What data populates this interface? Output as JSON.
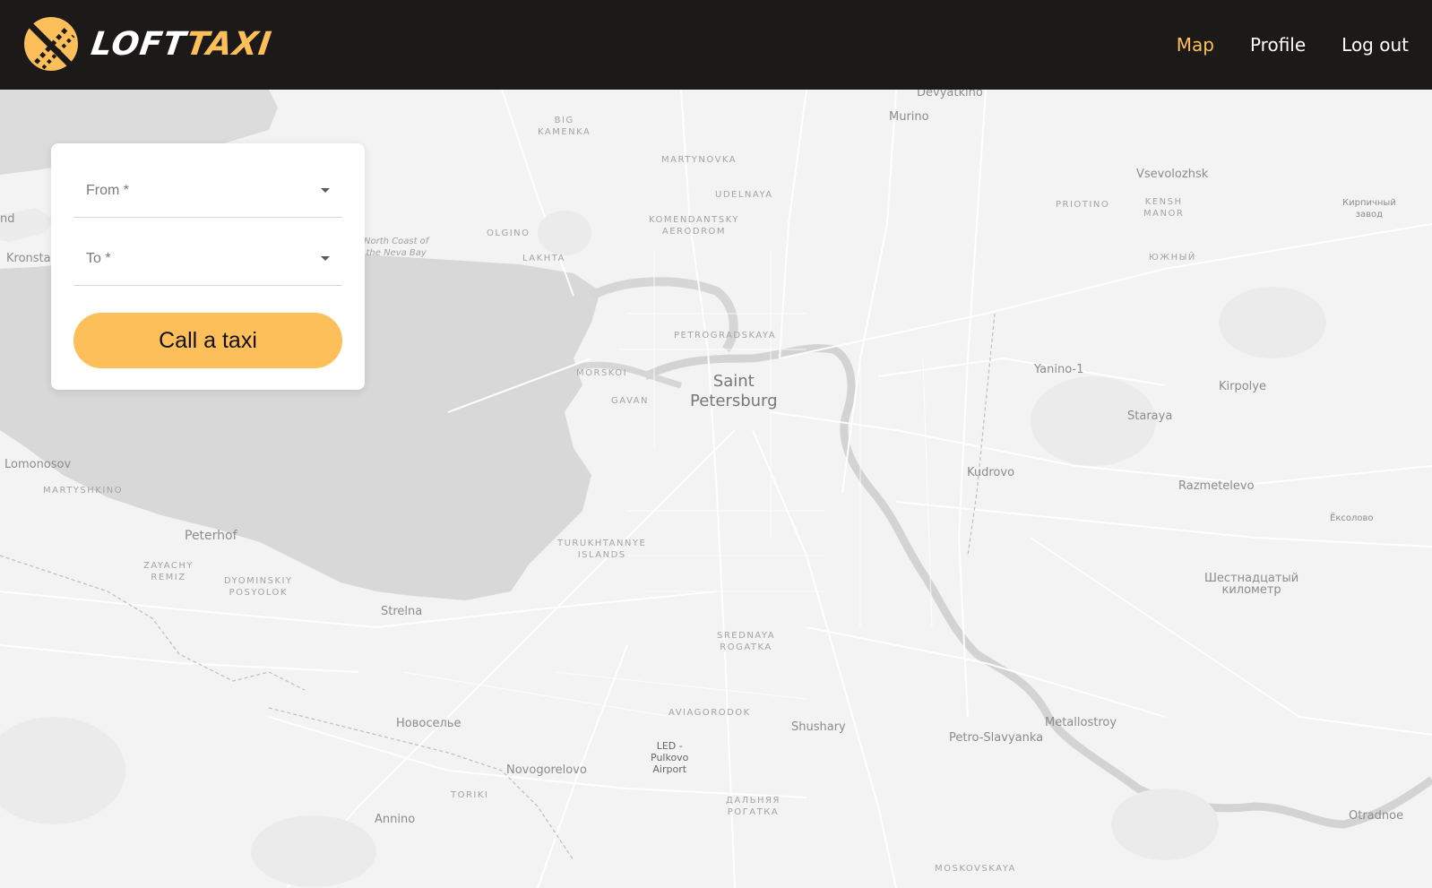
{
  "brand": {
    "name_part1": "LOFT",
    "name_part2": "TAXI",
    "accent_color": "#fdbf5a",
    "header_color": "#1c1a19"
  },
  "nav": {
    "items": [
      {
        "label": "Map",
        "active": true
      },
      {
        "label": "Profile",
        "active": false
      },
      {
        "label": "Log out",
        "active": false
      }
    ]
  },
  "order_form": {
    "from_label": "From *",
    "to_label": "To *",
    "submit_label": "Call a taxi"
  },
  "map": {
    "labels": [
      {
        "text": "Devyatkino",
        "kind": "town"
      },
      {
        "text": "Murino",
        "kind": "town"
      },
      {
        "text": "BIG\nKAMENKA",
        "kind": "district"
      },
      {
        "text": "MARTYNOVKA",
        "kind": "district"
      },
      {
        "text": "UDELNAYA",
        "kind": "district"
      },
      {
        "text": "KOMENDANTSKY\nAERODROM",
        "kind": "district"
      },
      {
        "text": "OLGINO",
        "kind": "district"
      },
      {
        "text": "LAKHTA",
        "kind": "district"
      },
      {
        "text": "North Coast of\nthe Neva Bay",
        "kind": "water"
      },
      {
        "text": "Kronstad",
        "kind": "town"
      },
      {
        "text": "nd",
        "kind": "town"
      },
      {
        "text": "Vsevolozhsk",
        "kind": "town"
      },
      {
        "text": "PRIOTINO",
        "kind": "district"
      },
      {
        "text": "KENSH\nMANOR",
        "kind": "district"
      },
      {
        "text": "Кирпичный\nзавод",
        "kind": "town"
      },
      {
        "text": "ЮЖНЫЙ",
        "kind": "district"
      },
      {
        "text": "PETROGRADSKAYA",
        "kind": "district"
      },
      {
        "text": "MORSKOI",
        "kind": "district"
      },
      {
        "text": "GAVAN",
        "kind": "district"
      },
      {
        "text": "Saint\nPetersburg",
        "kind": "city"
      },
      {
        "text": "Yanino-1",
        "kind": "town"
      },
      {
        "text": "Kirpolye",
        "kind": "town"
      },
      {
        "text": "Staraya",
        "kind": "town"
      },
      {
        "text": "Kudrovo",
        "kind": "town"
      },
      {
        "text": "Razmetelevo",
        "kind": "town"
      },
      {
        "text": "Lomonosov",
        "kind": "town"
      },
      {
        "text": "MARTYSHKINO",
        "kind": "district"
      },
      {
        "text": "Peterhof",
        "kind": "town"
      },
      {
        "text": "ZAYACHY\nREMIZ",
        "kind": "district"
      },
      {
        "text": "DYOMINSKIY\nPOSYOLOK",
        "kind": "district"
      },
      {
        "text": "TURUKHTANNYE\nISLANDS",
        "kind": "district"
      },
      {
        "text": "Ёксолово",
        "kind": "town"
      },
      {
        "text": "Шестнадцатый\nкилометр",
        "kind": "town"
      },
      {
        "text": "Strelna",
        "kind": "town"
      },
      {
        "text": "SREDNAYA\nROGATKA",
        "kind": "district"
      },
      {
        "text": "AVIAGORODOK",
        "kind": "district"
      },
      {
        "text": "Shushary",
        "kind": "town"
      },
      {
        "text": "Metallostroy",
        "kind": "town"
      },
      {
        "text": "Petro-Slavyanka",
        "kind": "town"
      },
      {
        "text": "Новоселье",
        "kind": "town"
      },
      {
        "text": "LED -\nPulkovo\nAirport",
        "kind": "town"
      },
      {
        "text": "Novogorelovo",
        "kind": "town"
      },
      {
        "text": "TORIKI",
        "kind": "district"
      },
      {
        "text": "ДАЛЬНЯЯ\nРОГАТКА",
        "kind": "district"
      },
      {
        "text": "Annino",
        "kind": "town"
      },
      {
        "text": "Otradnoe",
        "kind": "town"
      },
      {
        "text": "MOSKOVSKAYA",
        "kind": "district"
      }
    ]
  }
}
